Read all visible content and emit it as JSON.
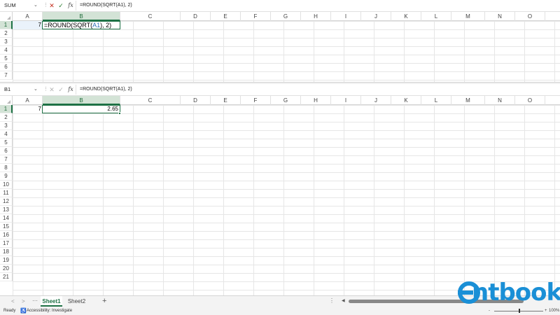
{
  "colors": {
    "accent": "#1e7145",
    "cancel": "#c42b1c",
    "enter": "#2e7d32",
    "reference": "#2f6fb6",
    "watermark": "#1a8fd6"
  },
  "top_pane": {
    "name_box": "SUM",
    "formula": "=ROUND(SQRT(A1), 2)",
    "columns": [
      "A",
      "B",
      "C",
      "D",
      "E",
      "F",
      "G",
      "H",
      "I",
      "J",
      "K",
      "L",
      "M",
      "N",
      "O"
    ],
    "rows": [
      "1",
      "2",
      "3",
      "4",
      "5",
      "6",
      "7"
    ],
    "cells": {
      "a1": "7",
      "b1_prefix": "=ROUND(SQRT(",
      "b1_ref": "A1",
      "b1_suffix": "), 2)"
    }
  },
  "bottom_pane": {
    "name_box": "B1",
    "formula": "=ROUND(SQRT(A1), 2)",
    "columns": [
      "A",
      "B",
      "C",
      "D",
      "E",
      "F",
      "G",
      "H",
      "I",
      "J",
      "K",
      "L",
      "M",
      "N",
      "O"
    ],
    "rows": [
      "1",
      "2",
      "3",
      "4",
      "5",
      "6",
      "7",
      "8",
      "9",
      "10",
      "11",
      "12",
      "13",
      "14",
      "15",
      "16",
      "17",
      "18",
      "19",
      "20",
      "21"
    ],
    "cells": {
      "a1": "7",
      "b1": "2.65"
    }
  },
  "sheet_tabs": [
    {
      "label": "Sheet1",
      "active": true
    },
    {
      "label": "Sheet2",
      "active": false
    }
  ],
  "add_sheet": "+",
  "status": {
    "ready": "Ready",
    "accessibility": "Accessibility: Investigate",
    "zoom_minus": "-",
    "zoom_plus": "+",
    "zoom_level": "100%"
  },
  "watermark": {
    "text": "ntbook"
  }
}
